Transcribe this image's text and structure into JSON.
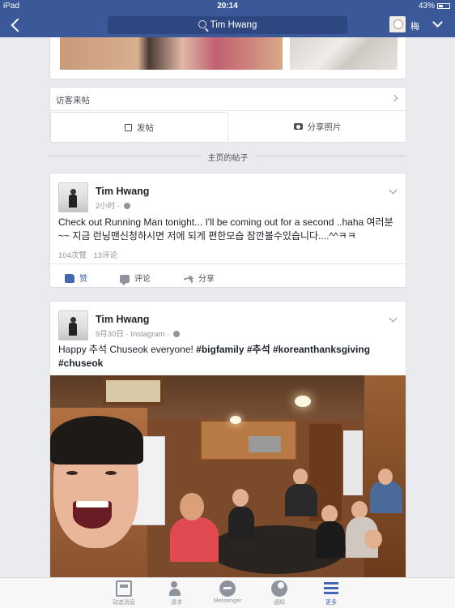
{
  "status_bar": {
    "device": "iPad",
    "time": "20:14",
    "battery": "43%"
  },
  "nav": {
    "search_text": "Tim Hwang",
    "profile_name": "梅"
  },
  "visitor_posts": {
    "title": "访客来帖",
    "post_label": "发帖",
    "share_photo_label": "分享照片"
  },
  "section_divider": "主页的帖子",
  "posts": [
    {
      "author": "Tim Hwang",
      "time": "2小时",
      "source": "",
      "text": "Check out Running Man tonight... I'll be coming out for a second ..haha 여러분~~ 지금 런닝맨신청하시면 저에 되게 편한모습 잠깐볼수있습니다....^^ㅋㅋ",
      "likes": "104次赞",
      "comments": "13评论",
      "actions": {
        "like": "赞",
        "comment": "评论",
        "share": "分享"
      }
    },
    {
      "author": "Tim Hwang",
      "time": "9月30日",
      "source": "Instagram",
      "text_plain": "Happy 추석 Chuseok everyone! ",
      "hashtags": [
        "#bigfamily",
        "#추석",
        "#koreanthanksgiving",
        "#chuseok"
      ]
    }
  ],
  "tab_bar": {
    "tabs": [
      {
        "label": "动态消息",
        "icon": "news-feed-icon"
      },
      {
        "label": "请求",
        "icon": "friend-requests-icon"
      },
      {
        "label": "Messenger",
        "icon": "messenger-icon"
      },
      {
        "label": "通知",
        "icon": "notifications-globe-icon"
      },
      {
        "label": "更多",
        "icon": "more-menu-icon"
      }
    ]
  },
  "colors": {
    "brand_blue": "#3b5998",
    "link_blue": "#4267b2",
    "background": "#e9ebee"
  }
}
